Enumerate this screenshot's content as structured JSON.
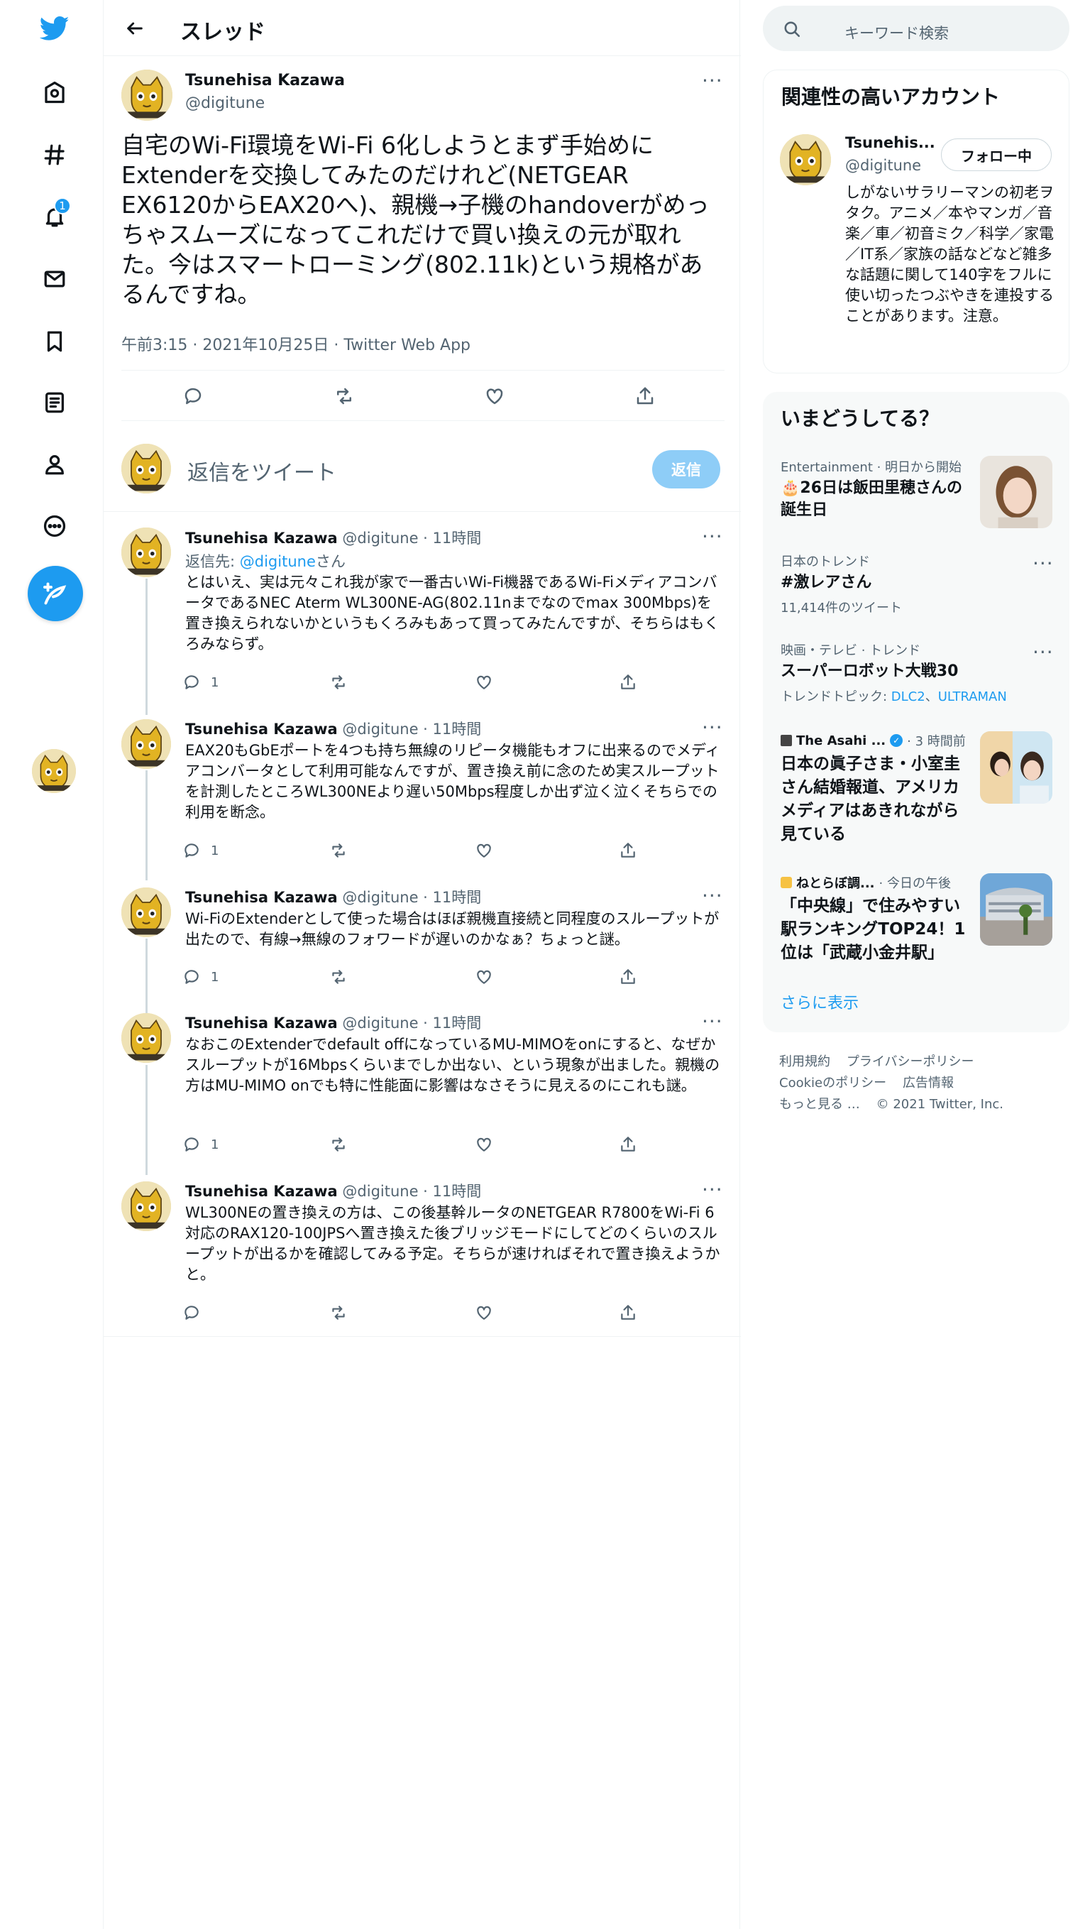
{
  "nav": {
    "notification_count": "1"
  },
  "header": {
    "title": "スレッド"
  },
  "main_tweet": {
    "name": "Tsunehisa Kazawa",
    "handle": "@digitune",
    "text": "自宅のWi-Fi環境をWi-Fi 6化しようとまず手始めにExtenderを交換してみたのだけれど(NETGEAR EX6120からEAX20へ)、親機→子機のhandoverがめっちゃスムーズになってこれだけで買い換えの元が取れた。今はスマートローミング(802.11k)という規格があるんですね。",
    "meta": "午前3:15 · 2021年10月25日 · Twitter Web App"
  },
  "reply_box": {
    "placeholder": "返信をツイート",
    "button": "返信"
  },
  "replies": [
    {
      "name": "Tsunehisa Kazawa",
      "handle_time": "@digitune · 11時間",
      "reply_to_prefix": "返信先: ",
      "reply_to_handle": "@digitune",
      "reply_to_suffix": "さん",
      "text": "とはいえ、実は元々これ我が家で一番古いWi-Fi機器であるWi-FiメディアコンバータであるNEC Aterm WL300NE-AG(802.11nまでなのでmax 300Mbps)を置き換えられないかというもくろみもあって買ってみたんですが、そちらはもくろみならず。",
      "reply_count": "1"
    },
    {
      "name": "Tsunehisa Kazawa",
      "handle_time": "@digitune · 11時間",
      "text": "EAX20もGbEポートを4つも持ち無線のリピータ機能もオフに出来るのでメディアコンバータとして利用可能なんですが、置き換え前に念のため実スループットを計測したところWL300NEより遅い50Mbps程度しか出ず泣く泣くそちらでの利用を断念。",
      "reply_count": "1"
    },
    {
      "name": "Tsunehisa Kazawa",
      "handle_time": "@digitune · 11時間",
      "text": "Wi-FiのExtenderとして使った場合はほぼ親機直接続と同程度のスループットが出たので、有線→無線のフォワードが遅いのかなぁ？ちょっと謎。",
      "reply_count": "1"
    },
    {
      "name": "Tsunehisa Kazawa",
      "handle_time": "@digitune · 11時間",
      "text": "なおこのExtenderでdefault offになっているMU-MIMOをonにすると、なぜかスループットが16Mbpsくらいまでしか出ない、という現象が出ました。親機の方はMU-MIMO onでも特に性能面に影響はなさそうに見えるのにこれも謎。",
      "reply_count": "1"
    },
    {
      "name": "Tsunehisa Kazawa",
      "handle_time": "@digitune · 11時間",
      "text": "WL300NEの置き換えの方は、この後基幹ルータのNETGEAR R7800をWi-Fi 6対応のRAX120-100JPSへ置き換えた後ブリッジモードにしてどのくらいのスループットが出るかを確認してみる予定。そちらが速ければそれで置き換えようかと。",
      "reply_count": ""
    }
  ],
  "search": {
    "placeholder": "キーワード検索"
  },
  "related": {
    "title": "関連性の高いアカウント",
    "name": "Tsunehis...",
    "handle": "@digitune",
    "follow_button": "フォロー中",
    "bio": "しがないサラリーマンの初老ヲタク。アニメ／本やマンガ／音楽／車／初音ミク／科学／家電／IT系／家族の話などなど雑多な話題に関して140字をフルに使い切ったつぶやきを連投することがあります。注意。"
  },
  "trends": {
    "title": "いまどうしてる？",
    "items": [
      {
        "meta": "Entertainment · 明日から開始",
        "title": "🎂26日は飯田里穂さんの誕生日"
      },
      {
        "meta": "日本のトレンド",
        "title": "#激レアさん",
        "sub": "11,414件のツイート"
      },
      {
        "meta": "映画・テレビ · トレンド",
        "title": "スーパーロボット大戦30",
        "sub_prefix": "トレンドトピック: ",
        "sub_link1": "DLC2",
        "sub_sep": "、",
        "sub_link2": "ULTRAMAN"
      },
      {
        "source": "The Asahi ...",
        "time": "· 3 時間前",
        "title": "日本の眞子さま・小室圭さん結婚報道、アメリカメディアはあきれながら見ている"
      },
      {
        "source": "ねとらぼ調...",
        "time": "· 今日の午後",
        "title": "「中央線」で住みやすい駅ランキングTOP24！1位は「武蔵小金井駅」"
      }
    ],
    "show_more": "さらに表示"
  },
  "footer": {
    "terms": "利用規約",
    "privacy": "プライバシーポリシー",
    "cookie": "Cookieのポリシー",
    "ads": "広告情報",
    "more": "もっと見る …",
    "copyright": "© 2021 Twitter, Inc."
  },
  "colors": {
    "accent": "#1d9bf0",
    "text": "#0f1419",
    "secondary": "#536471",
    "panel_bg": "#f7f9f9"
  }
}
